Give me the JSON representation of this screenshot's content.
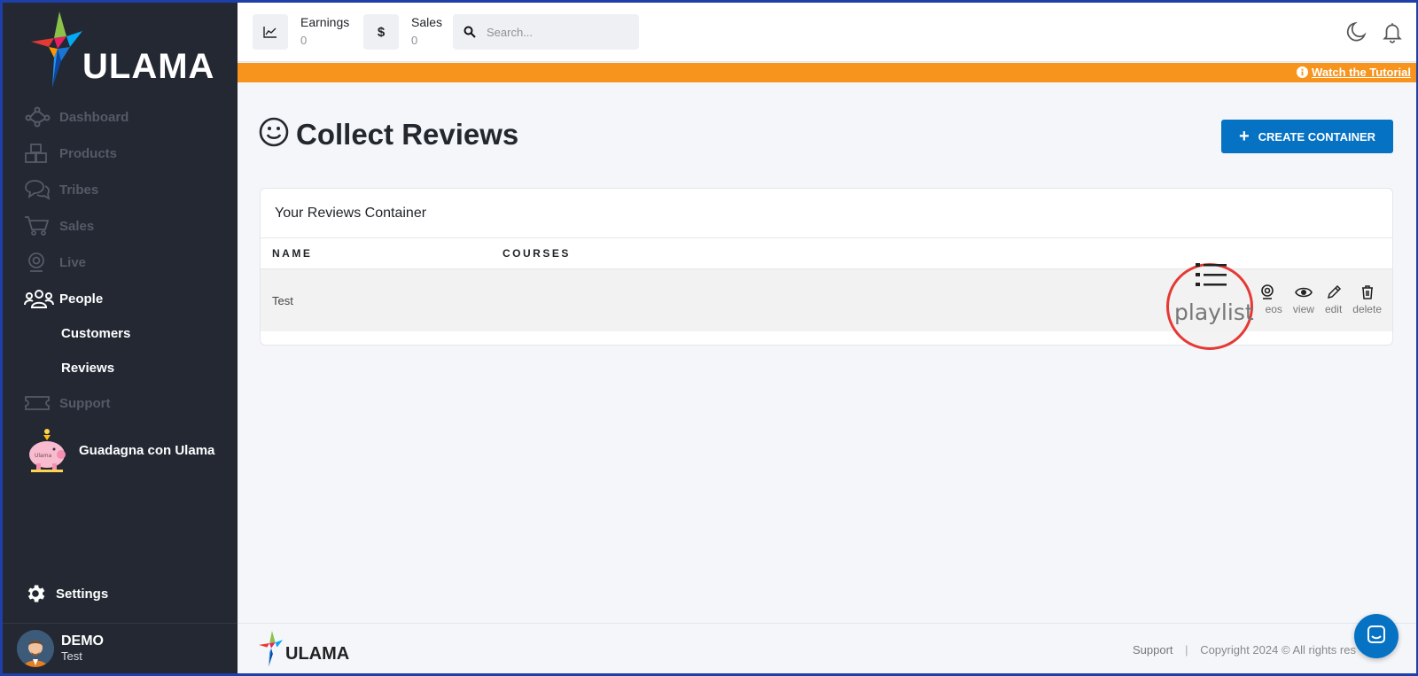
{
  "brand": {
    "name": "ULAMA"
  },
  "sidebar": {
    "items": [
      {
        "label": "Dashboard",
        "icon": "network-icon"
      },
      {
        "label": "Products",
        "icon": "boxes-icon"
      },
      {
        "label": "Tribes",
        "icon": "chat-bubbles-icon"
      },
      {
        "label": "Sales",
        "icon": "cart-icon"
      },
      {
        "label": "Live",
        "icon": "webcam-icon"
      },
      {
        "label": "People",
        "icon": "users-icon"
      }
    ],
    "sub_items": [
      "Customers",
      "Reviews"
    ],
    "support_label": "Support",
    "promo_label": "Guadagna con Ulama",
    "settings_label": "Settings",
    "user": {
      "name": "DEMO",
      "sub": "Test"
    }
  },
  "topbar": {
    "earnings": {
      "label": "Earnings",
      "value": "0"
    },
    "sales": {
      "label": "Sales",
      "value": "0",
      "icon": "$"
    },
    "search": {
      "placeholder": "Search..."
    }
  },
  "banner": {
    "tutorial_label": "Watch the Tutorial"
  },
  "main": {
    "title": "Collect Reviews",
    "create_button": "CREATE CONTAINER",
    "card_title": "Your Reviews Container",
    "columns": [
      "NAME",
      "COURSES"
    ],
    "rows": [
      {
        "name": "Test"
      }
    ],
    "actions": {
      "videos": "eos",
      "view": "view",
      "edit": "edit",
      "delete": "delete"
    },
    "highlight_label": "playlist"
  },
  "footer": {
    "support": "Support",
    "separator": "|",
    "copyright": "Copyright 2024 © All rights res"
  },
  "colors": {
    "sidebar_bg": "#232833",
    "accent_blue": "#0672c4",
    "banner_orange": "#f7941d",
    "highlight_red": "#e53935"
  }
}
